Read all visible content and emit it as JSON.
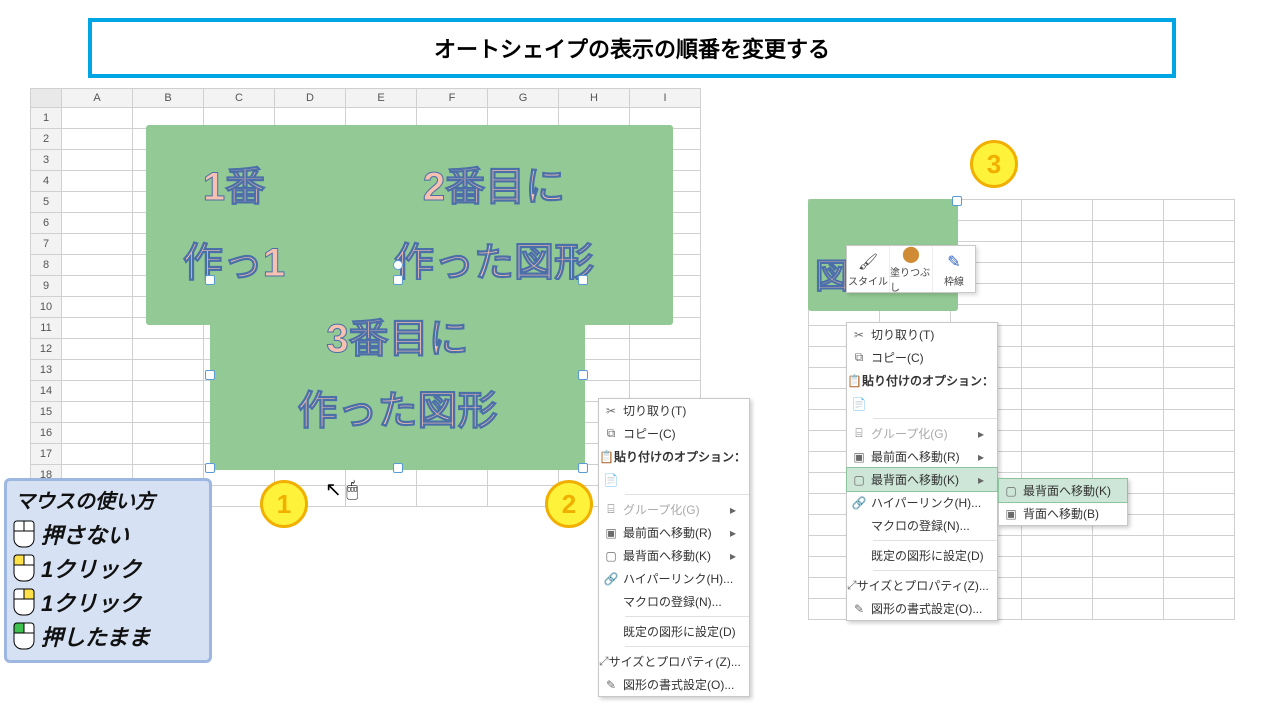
{
  "title": "オートシェイプの表示の順番を変更する",
  "columns": [
    "A",
    "B",
    "C",
    "D",
    "E",
    "F",
    "G",
    "H",
    "I"
  ],
  "columns2": [
    "",
    "",
    "",
    "",
    "",
    ""
  ],
  "rows": 19,
  "shapes": {
    "s1": {
      "line1": "1番",
      "line2": "作っ1"
    },
    "s2": {
      "line1": "2番目に",
      "line2": "作った図形"
    },
    "s3": {
      "line1": "3番目に",
      "line2": "作った図形"
    },
    "s4": {
      "line1": "",
      "line2": "図"
    }
  },
  "steps": {
    "n1": "1",
    "n2": "2",
    "n3": "3"
  },
  "mini_toolbar": {
    "style": "スタイル",
    "fill": "塗りつぶし",
    "outline": "枠線",
    "glyph_style": "🖌",
    "glyph_fill": "⬤",
    "glyph_outline": "✎"
  },
  "menu": {
    "cut": {
      "icon": "✂",
      "label": "切り取り(T)"
    },
    "copy": {
      "icon": "⧉",
      "label": "コピー(C)"
    },
    "paste_opt": {
      "icon": "📋",
      "label": "貼り付けのオプション："
    },
    "paste_pic": {
      "icon": "📄",
      "label": ""
    },
    "group": {
      "icon": "⌸",
      "label": "グループ化(G)"
    },
    "bring_front": {
      "icon": "▣",
      "label": "最前面へ移動(R)"
    },
    "send_back": {
      "icon": "▢",
      "label": "最背面へ移動(K)"
    },
    "hyperlink": {
      "icon": "🔗",
      "label": "ハイパーリンク(H)..."
    },
    "macro": {
      "icon": "",
      "label": "マクロの登録(N)..."
    },
    "default": {
      "icon": "",
      "label": "既定の図形に設定(D)"
    },
    "sizeprop": {
      "icon": "⤢",
      "label": "サイズとプロパティ(Z)..."
    },
    "format": {
      "icon": "✎",
      "label": "図形の書式設定(O)..."
    }
  },
  "submenu": {
    "send_back": {
      "icon": "▢",
      "label": "最背面へ移動(K)"
    },
    "send_backward": {
      "icon": "▣",
      "label": "背面へ移動(B)"
    }
  },
  "legend": {
    "title": "マウスの使い方",
    "none": "押さない",
    "left1": "1クリック",
    "right1": "1クリック",
    "hold": "押したまま"
  },
  "colors": {
    "title_border": "#00A5E3",
    "shape_fill": "#93C994",
    "shape_text": "#F6C1B0",
    "step_fill": "#fff23a",
    "step_border": "#f1af00",
    "highlight": "#CDE6D7"
  }
}
